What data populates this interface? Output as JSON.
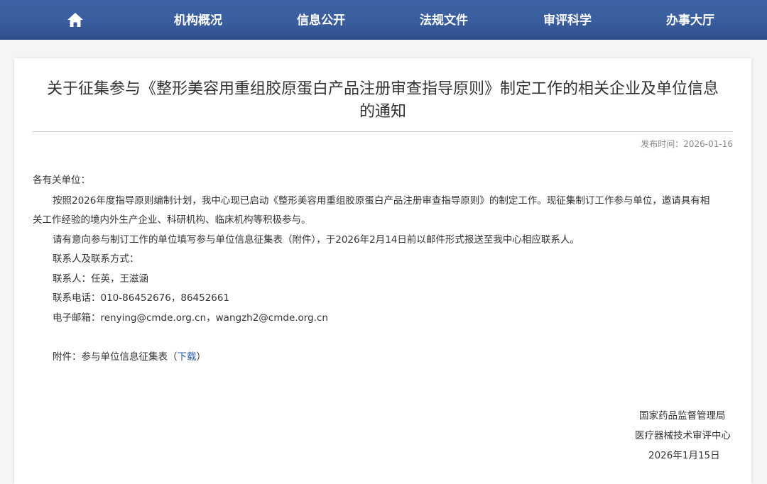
{
  "nav": {
    "home_icon": "home-icon",
    "items": [
      "机构概况",
      "信息公开",
      "法规文件",
      "审评科学",
      "办事大厅"
    ]
  },
  "article": {
    "title_line1": "关于征集参与《整形美容用重组胶原蛋白产品注册审查指导原则》制定工作的相关企业及单位信息",
    "title_line2": "的通知",
    "publish_label": "发布时间：",
    "publish_date": "2026-01-16",
    "greeting": "各有关单位：",
    "para1_line1": "按照2026年度指导原则编制计划，我中心现已启动《整形美容用重组胶原蛋白产品注册审查指导原则》的制定工作。现征集制订工作参与单位，邀请具有相",
    "para1_line2": "关工作经验的境内外生产企业、科研机构、临床机构等积极参与。",
    "para2": "请有意向参与制订工作的单位填写参与单位信息征集表（附件），于2026年2月14日前以邮件形式报送至我中心相应联系人。",
    "contact_heading": "联系人及联系方式：",
    "contact_people": "联系人：任英，王滋涵",
    "contact_phone": "联系电话：010-86452676，86452661",
    "contact_email": "电子邮箱：renying@cmde.org.cn，wangzh2@cmde.org.cn",
    "attachment_prefix": "附件：参与单位信息征集表（",
    "attachment_link": "下载",
    "attachment_suffix": "）",
    "sign_org1": "国家药品监督管理局",
    "sign_org2": "医疗器械技术审评中心",
    "sign_date": "2026年1月15日"
  },
  "colors": {
    "nav_bg": "#3a5e9f",
    "link": "#2a5caa"
  }
}
